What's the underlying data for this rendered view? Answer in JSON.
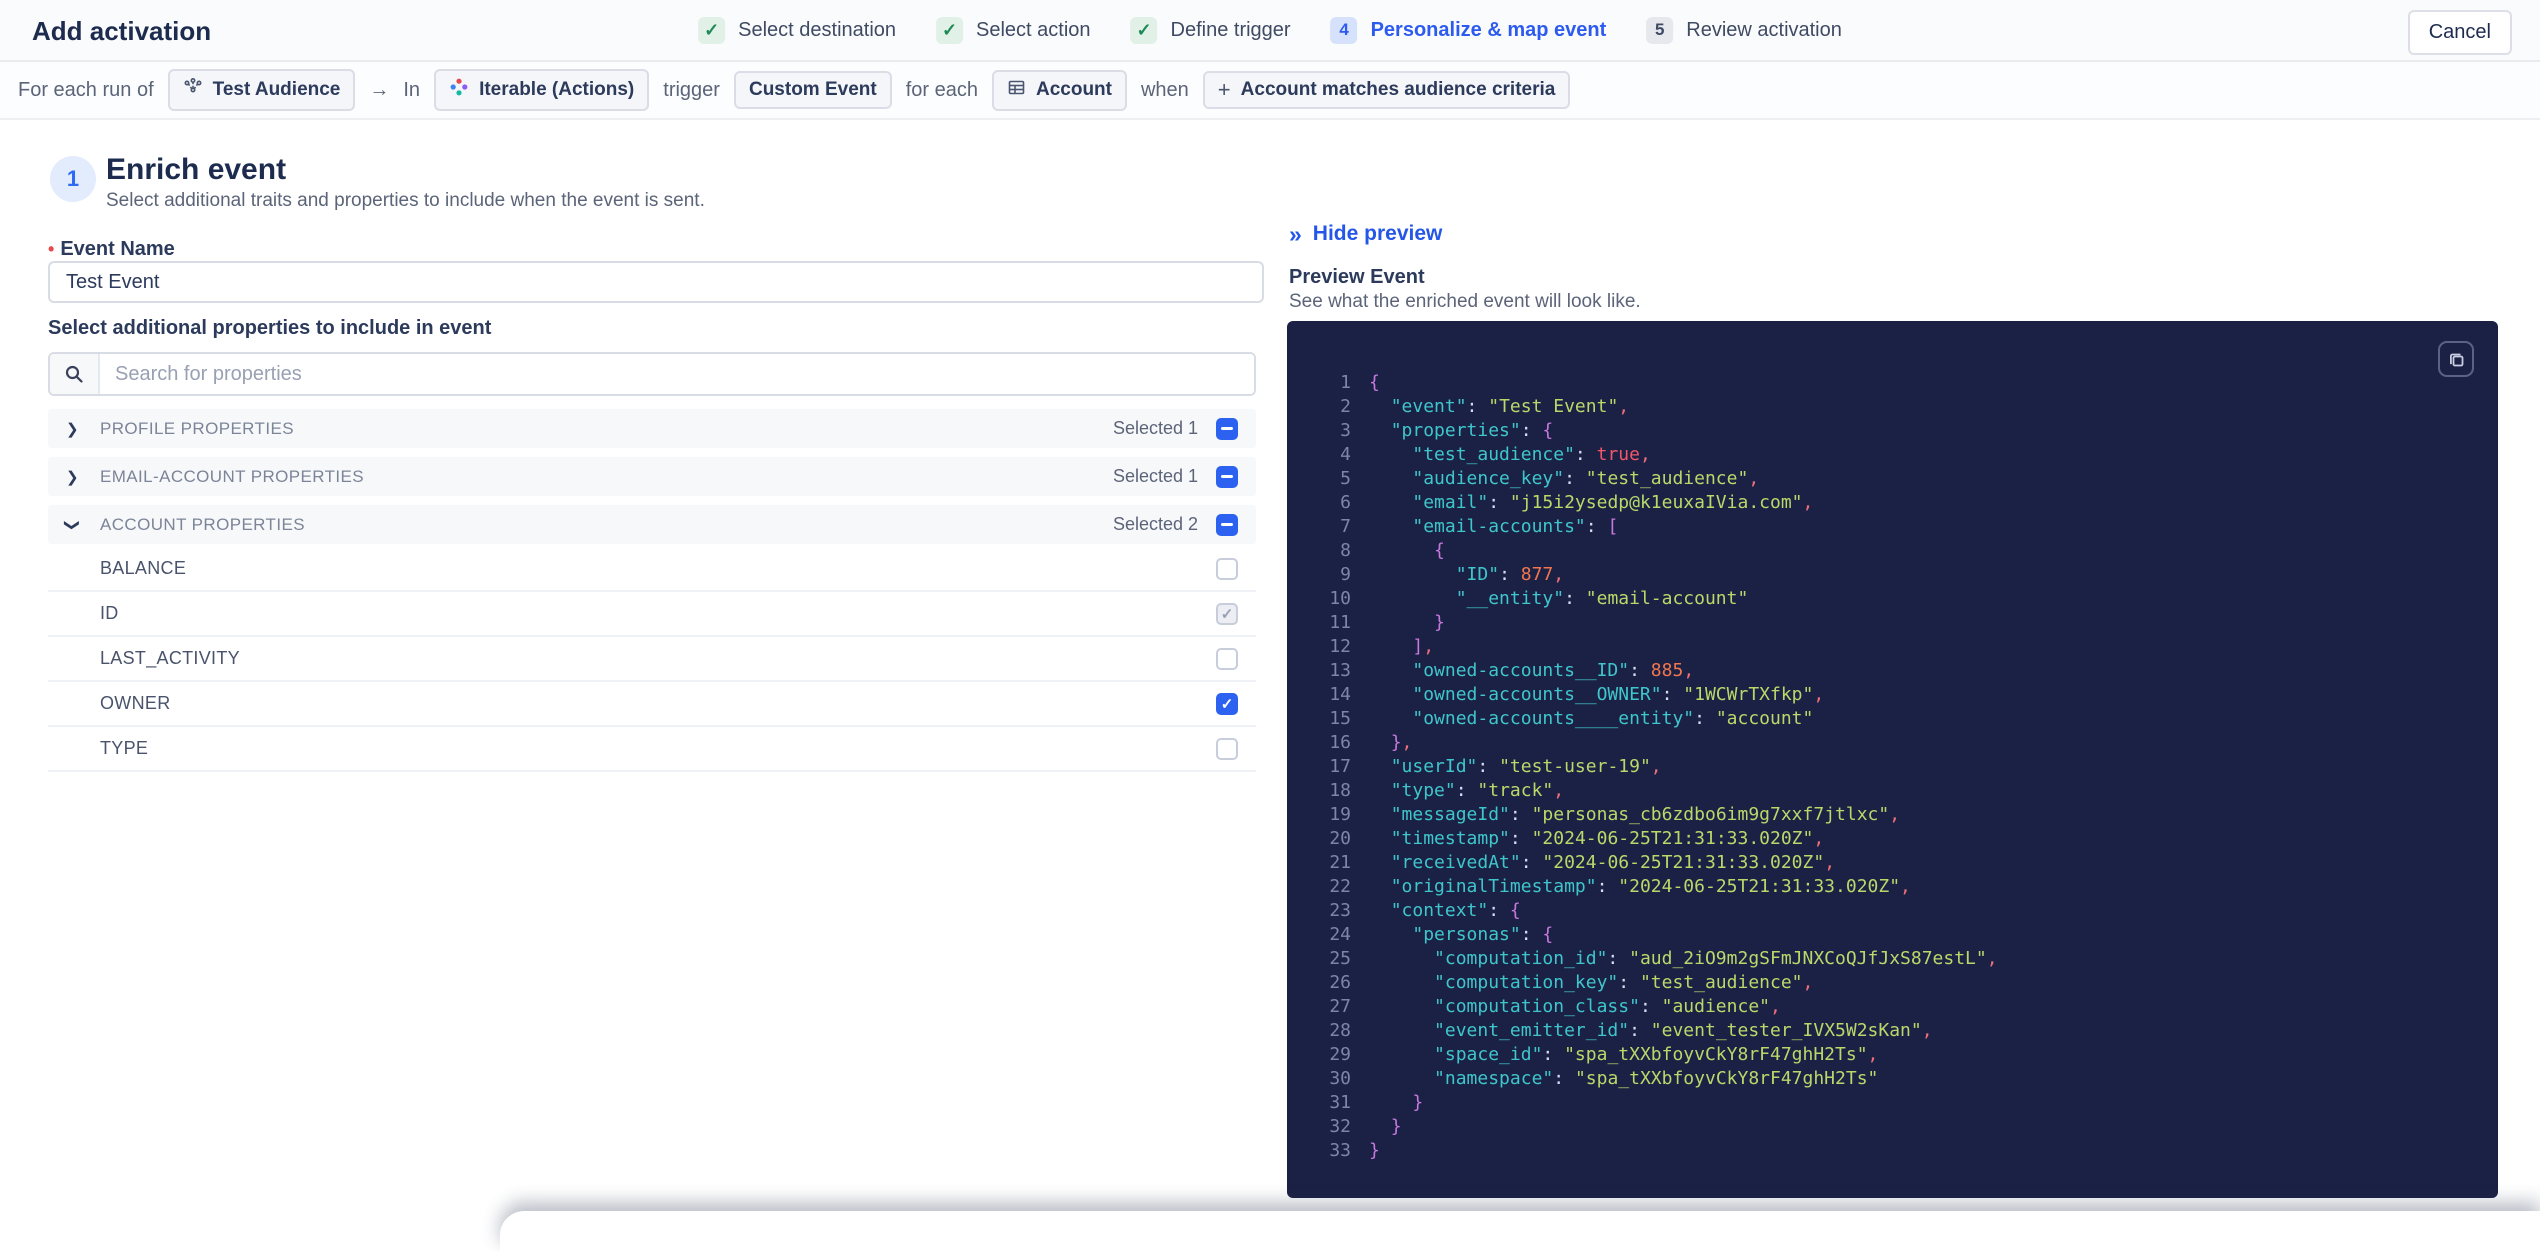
{
  "colors": {
    "accent_blue": "#2d5bf0",
    "check_green": "#1f8a56",
    "required_red": "#e5484d",
    "checkbox_blue": "#2d62f0",
    "code_background": "#1b2144",
    "code_key": "#3fc6cc",
    "code_string": "#b8d96a",
    "code_number": "#f0764f",
    "code_boolean": "#f2566a",
    "code_brace": "#c678dd"
  },
  "header": {
    "title": "Add activation",
    "cancel_label": "Cancel",
    "steps": [
      {
        "status": "done",
        "label": "Select destination"
      },
      {
        "status": "done",
        "label": "Select action"
      },
      {
        "status": "done",
        "label": "Define trigger"
      },
      {
        "status": "active",
        "num": "4",
        "label": "Personalize & map event"
      },
      {
        "status": "upcoming",
        "num": "5",
        "label": "Review activation"
      }
    ]
  },
  "summary": {
    "items": [
      {
        "type": "text",
        "text": "For each run of"
      },
      {
        "type": "badge",
        "icon": "audience-icon",
        "label": "Test Audience"
      },
      {
        "type": "text",
        "text": "→"
      },
      {
        "type": "text",
        "text": "In"
      },
      {
        "type": "badge",
        "icon": "iterable-icon",
        "label": "Iterable (Actions)"
      },
      {
        "type": "text",
        "text": "trigger"
      },
      {
        "type": "badge",
        "label": "Custom Event"
      },
      {
        "type": "text",
        "text": "for each"
      },
      {
        "type": "badge",
        "icon": "table-icon",
        "label": "Account"
      },
      {
        "type": "text",
        "text": "when"
      },
      {
        "type": "badge",
        "icon": "plus-icon",
        "label": "Account matches audience criteria"
      }
    ]
  },
  "enrich": {
    "step_number": "1",
    "title": "Enrich event",
    "subtitle": "Select additional traits and properties to include when the event is sent.",
    "event_name": {
      "required_marker": "•",
      "label": "Event Name",
      "value": "Test Event"
    },
    "properties_label": "Select additional properties to include in event",
    "search_placeholder": "Search for properties",
    "groups": [
      {
        "label": "PROFILE PROPERTIES",
        "selected": "Selected 1",
        "expanded": false,
        "checkbox": "indeterminate"
      },
      {
        "label": "EMAIL-ACCOUNT PROPERTIES",
        "selected": "Selected 1",
        "expanded": false,
        "checkbox": "indeterminate"
      },
      {
        "label": "ACCOUNT PROPERTIES",
        "selected": "Selected 2",
        "expanded": true,
        "checkbox": "indeterminate"
      }
    ],
    "account_properties": [
      {
        "label": "BALANCE",
        "state": "unchecked"
      },
      {
        "label": "ID",
        "state": "checked-disabled"
      },
      {
        "label": "LAST_ACTIVITY",
        "state": "unchecked"
      },
      {
        "label": "OWNER",
        "state": "checked"
      },
      {
        "label": "TYPE",
        "state": "unchecked"
      }
    ]
  },
  "preview": {
    "hide_icon": "»",
    "hide_label": "Hide preview",
    "title": "Preview Event",
    "subtitle": "See what the enriched event will look like.",
    "copy_icon": "copy-icon",
    "code_lines": [
      [
        [
          "brc",
          "{"
        ]
      ],
      [
        [
          "ws",
          "  "
        ],
        [
          "key",
          "\"event\""
        ],
        [
          "pun",
          ": "
        ],
        [
          "str",
          "\"Test Event\""
        ],
        [
          "com",
          ","
        ]
      ],
      [
        [
          "ws",
          "  "
        ],
        [
          "key",
          "\"properties\""
        ],
        [
          "pun",
          ": "
        ],
        [
          "brc",
          "{"
        ]
      ],
      [
        [
          "ws",
          "    "
        ],
        [
          "key",
          "\"test_audience\""
        ],
        [
          "pun",
          ": "
        ],
        [
          "boo",
          "true"
        ],
        [
          "com",
          ","
        ]
      ],
      [
        [
          "ws",
          "    "
        ],
        [
          "key",
          "\"audience_key\""
        ],
        [
          "pun",
          ": "
        ],
        [
          "str",
          "\"test_audience\""
        ],
        [
          "com",
          ","
        ]
      ],
      [
        [
          "ws",
          "    "
        ],
        [
          "key",
          "\"email\""
        ],
        [
          "pun",
          ": "
        ],
        [
          "str",
          "\"j15i2ysedp@k1euxaIVia.com\""
        ],
        [
          "com",
          ","
        ]
      ],
      [
        [
          "ws",
          "    "
        ],
        [
          "key",
          "\"email-accounts\""
        ],
        [
          "pun",
          ": "
        ],
        [
          "brc",
          "["
        ]
      ],
      [
        [
          "ws",
          "      "
        ],
        [
          "brc",
          "{"
        ]
      ],
      [
        [
          "ws",
          "        "
        ],
        [
          "key",
          "\"ID\""
        ],
        [
          "pun",
          ": "
        ],
        [
          "num",
          "877"
        ],
        [
          "com",
          ","
        ]
      ],
      [
        [
          "ws",
          "        "
        ],
        [
          "key",
          "\"__entity\""
        ],
        [
          "pun",
          ": "
        ],
        [
          "str",
          "\"email-account\""
        ]
      ],
      [
        [
          "ws",
          "      "
        ],
        [
          "brc",
          "}"
        ]
      ],
      [
        [
          "ws",
          "    "
        ],
        [
          "brc",
          "]"
        ],
        [
          "com",
          ","
        ]
      ],
      [
        [
          "ws",
          "    "
        ],
        [
          "key",
          "\"owned-accounts__ID\""
        ],
        [
          "pun",
          ": "
        ],
        [
          "num",
          "885"
        ],
        [
          "com",
          ","
        ]
      ],
      [
        [
          "ws",
          "    "
        ],
        [
          "key",
          "\"owned-accounts__OWNER\""
        ],
        [
          "pun",
          ": "
        ],
        [
          "str",
          "\"1WCWrTXfkp\""
        ],
        [
          "com",
          ","
        ]
      ],
      [
        [
          "ws",
          "    "
        ],
        [
          "key",
          "\"owned-accounts____entity\""
        ],
        [
          "pun",
          ": "
        ],
        [
          "str",
          "\"account\""
        ]
      ],
      [
        [
          "ws",
          "  "
        ],
        [
          "brc",
          "}"
        ],
        [
          "com",
          ","
        ]
      ],
      [
        [
          "ws",
          "  "
        ],
        [
          "key",
          "\"userId\""
        ],
        [
          "pun",
          ": "
        ],
        [
          "str",
          "\"test-user-19\""
        ],
        [
          "com",
          ","
        ]
      ],
      [
        [
          "ws",
          "  "
        ],
        [
          "key",
          "\"type\""
        ],
        [
          "pun",
          ": "
        ],
        [
          "str",
          "\"track\""
        ],
        [
          "com",
          ","
        ]
      ],
      [
        [
          "ws",
          "  "
        ],
        [
          "key",
          "\"messageId\""
        ],
        [
          "pun",
          ": "
        ],
        [
          "str",
          "\"personas_cb6zdbo6im9g7xxf7jtlxc\""
        ],
        [
          "com",
          ","
        ]
      ],
      [
        [
          "ws",
          "  "
        ],
        [
          "key",
          "\"timestamp\""
        ],
        [
          "pun",
          ": "
        ],
        [
          "str",
          "\"2024-06-25T21:31:33.020Z\""
        ],
        [
          "com",
          ","
        ]
      ],
      [
        [
          "ws",
          "  "
        ],
        [
          "key",
          "\"receivedAt\""
        ],
        [
          "pun",
          ": "
        ],
        [
          "str",
          "\"2024-06-25T21:31:33.020Z\""
        ],
        [
          "com",
          ","
        ]
      ],
      [
        [
          "ws",
          "  "
        ],
        [
          "key",
          "\"originalTimestamp\""
        ],
        [
          "pun",
          ": "
        ],
        [
          "str",
          "\"2024-06-25T21:31:33.020Z\""
        ],
        [
          "com",
          ","
        ]
      ],
      [
        [
          "ws",
          "  "
        ],
        [
          "key",
          "\"context\""
        ],
        [
          "pun",
          ": "
        ],
        [
          "brc",
          "{"
        ]
      ],
      [
        [
          "ws",
          "    "
        ],
        [
          "key",
          "\"personas\""
        ],
        [
          "pun",
          ": "
        ],
        [
          "brc",
          "{"
        ]
      ],
      [
        [
          "ws",
          "      "
        ],
        [
          "key",
          "\"computation_id\""
        ],
        [
          "pun",
          ": "
        ],
        [
          "str",
          "\"aud_2iO9m2gSFmJNXCoQJfJxS87estL\""
        ],
        [
          "com",
          ","
        ]
      ],
      [
        [
          "ws",
          "      "
        ],
        [
          "key",
          "\"computation_key\""
        ],
        [
          "pun",
          ": "
        ],
        [
          "str",
          "\"test_audience\""
        ],
        [
          "com",
          ","
        ]
      ],
      [
        [
          "ws",
          "      "
        ],
        [
          "key",
          "\"computation_class\""
        ],
        [
          "pun",
          ": "
        ],
        [
          "str",
          "\"audience\""
        ],
        [
          "com",
          ","
        ]
      ],
      [
        [
          "ws",
          "      "
        ],
        [
          "key",
          "\"event_emitter_id\""
        ],
        [
          "pun",
          ": "
        ],
        [
          "str",
          "\"event_tester_IVX5W2sKan\""
        ],
        [
          "com",
          ","
        ]
      ],
      [
        [
          "ws",
          "      "
        ],
        [
          "key",
          "\"space_id\""
        ],
        [
          "pun",
          ": "
        ],
        [
          "str",
          "\"spa_tXXbfoyvCkY8rF47ghH2Ts\""
        ],
        [
          "com",
          ","
        ]
      ],
      [
        [
          "ws",
          "      "
        ],
        [
          "key",
          "\"namespace\""
        ],
        [
          "pun",
          ": "
        ],
        [
          "str",
          "\"spa_tXXbfoyvCkY8rF47ghH2Ts\""
        ]
      ],
      [
        [
          "ws",
          "    "
        ],
        [
          "brc",
          "}"
        ]
      ],
      [
        [
          "ws",
          "  "
        ],
        [
          "brc",
          "}"
        ]
      ],
      [
        [
          "brc",
          "}"
        ]
      ]
    ]
  }
}
